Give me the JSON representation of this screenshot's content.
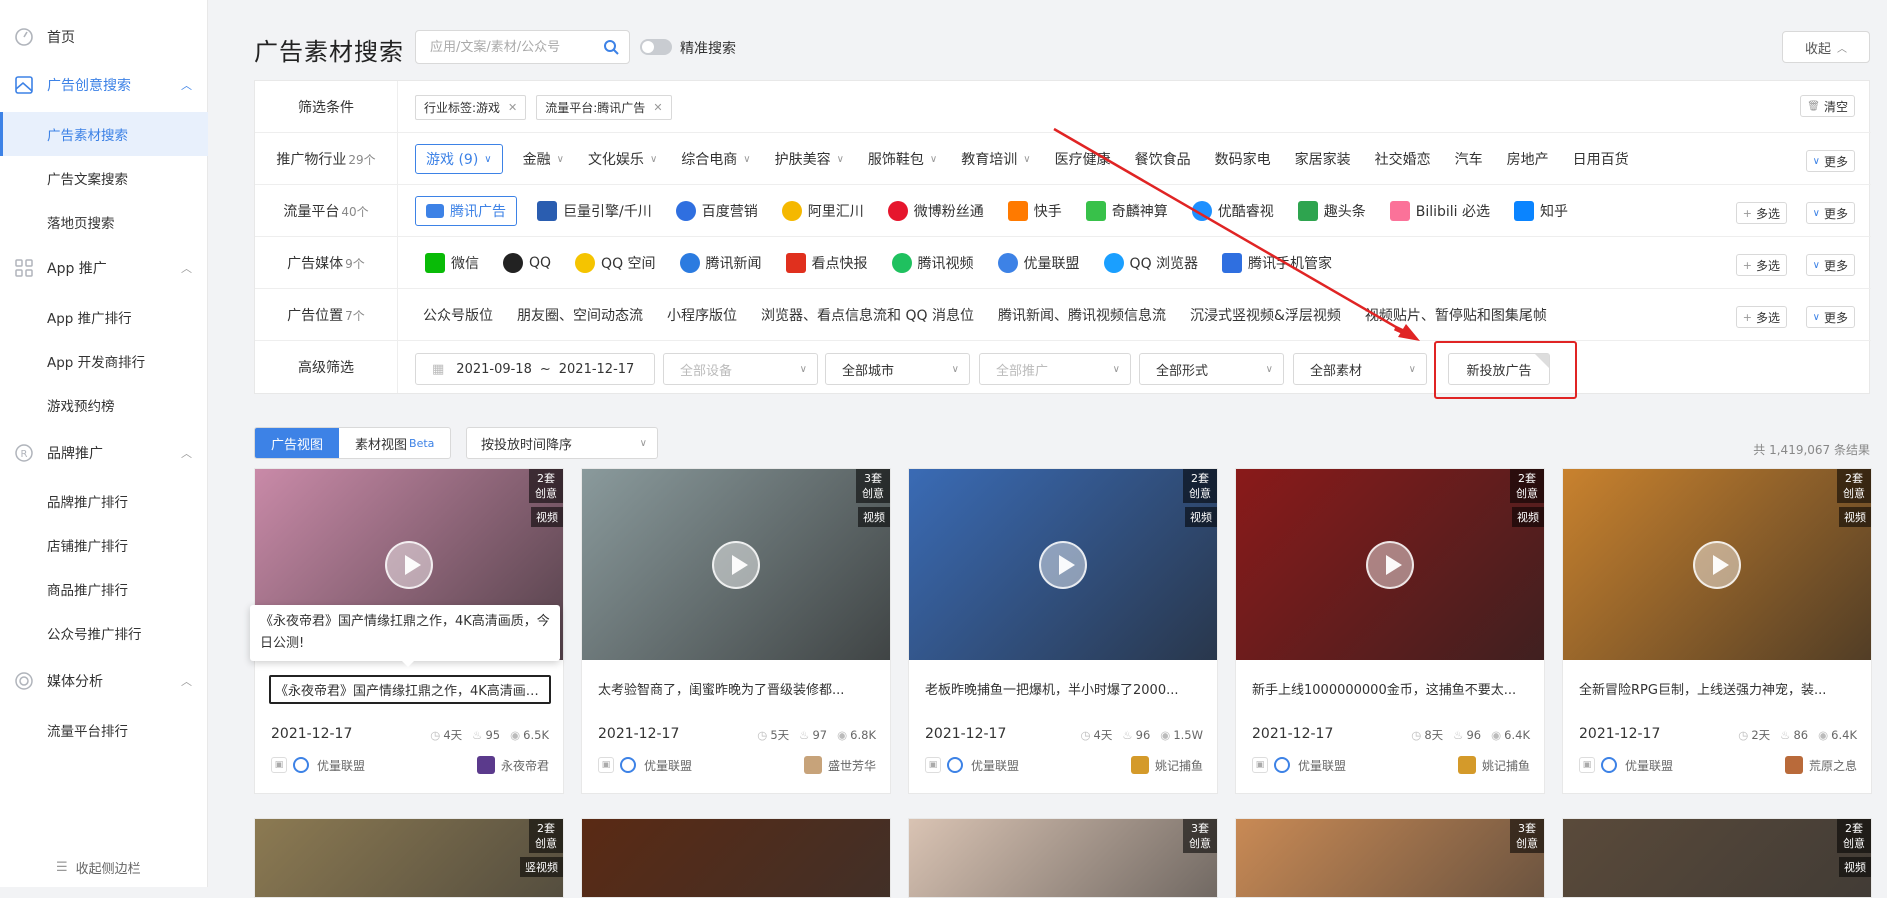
{
  "sidebar": {
    "items": [
      {
        "label": "首页",
        "icon": "dashboard-icon"
      },
      {
        "label": "广告创意搜索",
        "icon": "creative-icon"
      },
      {
        "label": "App 推广",
        "icon": "apps-icon"
      },
      {
        "label": "品牌推广",
        "icon": "brand-icon"
      },
      {
        "label": "媒体分析",
        "icon": "media-icon"
      }
    ],
    "sub_creative": [
      "广告素材搜索",
      "广告文案搜索",
      "落地页搜索"
    ],
    "sub_app": [
      "App 推广排行",
      "App 开发商排行",
      "游戏预约榜"
    ],
    "sub_brand": [
      "品牌推广排行",
      "店铺推广排行",
      "商品推广排行",
      "公众号推广排行"
    ],
    "sub_media": [
      "流量平台排行"
    ],
    "collapse_label": "收起侧边栏"
  },
  "header": {
    "title": "广告素材搜索",
    "search_placeholder": "应用/文案/素材/公众号",
    "precise_label": "精准搜索",
    "collapse_label": "收起"
  },
  "filters": {
    "conditions_label": "筛选条件",
    "active_tags": [
      "行业标签:游戏",
      "流量平台:腾讯广告"
    ],
    "clear_label": "清空",
    "industry": {
      "label": "推广物行业",
      "count": "29个",
      "selected": "游戏 (9)",
      "options": [
        "金融",
        "文化娱乐",
        "综合电商",
        "护肤美容",
        "服饰鞋包",
        "教育培训",
        "医疗健康",
        "餐饮食品",
        "数码家电",
        "家居家装",
        "社交婚恋",
        "汽车",
        "房地产",
        "日用百货"
      ]
    },
    "platform": {
      "label": "流量平台",
      "count": "40个",
      "selected": "腾讯广告",
      "options": [
        "巨量引擎/千川",
        "百度营销",
        "阿里汇川",
        "微博粉丝通",
        "快手",
        "奇麟神算",
        "优酷睿视",
        "趣头条",
        "Bilibili 必选",
        "知乎"
      ]
    },
    "media": {
      "label": "广告媒体",
      "count": "9个",
      "options": [
        "微信",
        "QQ",
        "QQ 空间",
        "腾讯新闻",
        "看点快报",
        "腾讯视频",
        "优量联盟",
        "QQ 浏览器",
        "腾讯手机管家"
      ]
    },
    "position": {
      "label": "广告位置",
      "count": "7个",
      "options": [
        "公众号版位",
        "朋友圈、空间动态流",
        "小程序版位",
        "浏览器、看点信息流和 QQ 消息位",
        "腾讯新闻、腾讯视频信息流",
        "沉浸式竖视频&浮层视频",
        "视频贴片、暂停贴和图集尾帧"
      ]
    },
    "advanced": {
      "label": "高级筛选",
      "date_start": "2021-09-18",
      "date_sep": "~",
      "date_end": "2021-12-17",
      "device": "全部设备",
      "city": "全部城市",
      "promo": "全部推广",
      "form": "全部形式",
      "material": "全部素材",
      "new_ads": "新投放广告"
    },
    "more_label": "更多",
    "multi_label": "多选"
  },
  "view": {
    "tab_ad": "广告视图",
    "tab_material": "素材视图",
    "beta": "Beta",
    "sort": "按投放时间降序",
    "total": "共 1,419,067 条结果"
  },
  "tooltip": "《永夜帝君》国产情缘扛鼎之作，4K高清画质，今日公测!",
  "cards": [
    {
      "badge1": "2套",
      "badge2": "创意",
      "type": "视频",
      "desc": "《永夜帝君》国产情缘扛鼎之作，4K高清画质，今日公测!",
      "date": "2021-12-17",
      "days": "4天",
      "heat": "95",
      "views": "6.5K",
      "media": "优量联盟",
      "advertiser": "永夜帝君",
      "bg": "#c98aa8",
      "av": "#5b3a8c"
    },
    {
      "badge1": "3套",
      "badge2": "创意",
      "type": "视频",
      "desc": "太考验智商了，闺蜜昨晚为了晋级装修都...",
      "date": "2021-12-17",
      "days": "5天",
      "heat": "97",
      "views": "6.8K",
      "media": "优量联盟",
      "advertiser": "盛世芳华",
      "bg": "#8a9a9c",
      "av": "#c7a37a"
    },
    {
      "badge1": "2套",
      "badge2": "创意",
      "type": "视频",
      "desc": "老板昨晚捕鱼一把爆机，半小时爆了2000...",
      "date": "2021-12-17",
      "days": "4天",
      "heat": "96",
      "views": "1.5W",
      "media": "优量联盟",
      "advertiser": "姚记捕鱼",
      "bg": "#3a6bb5",
      "av": "#d49a2a"
    },
    {
      "badge1": "2套",
      "badge2": "创意",
      "type": "视频",
      "desc": "新手上线1000000000金币，这捕鱼不要太...",
      "date": "2021-12-17",
      "days": "8天",
      "heat": "96",
      "views": "6.4K",
      "media": "优量联盟",
      "advertiser": "姚记捕鱼",
      "bg": "#8a1a1a",
      "av": "#d49a2a"
    },
    {
      "badge1": "2套",
      "badge2": "创意",
      "type": "视频",
      "desc": "全新冒险RPG巨制，上线送强力神宠，装...",
      "date": "2021-12-17",
      "days": "2天",
      "heat": "86",
      "views": "6.4K",
      "media": "优量联盟",
      "advertiser": "荒原之息",
      "bg": "#c9822e",
      "av": "#b96a3a"
    }
  ],
  "cards_row2": [
    {
      "badge1": "2套",
      "badge2": "创意",
      "type": "竖视频",
      "bg": "#8c7a52"
    },
    {
      "badge1": "",
      "badge2": "",
      "type": "",
      "bg": "#5a2a14"
    },
    {
      "badge1": "3套",
      "badge2": "创意",
      "type": "",
      "bg": "#d9c3b3"
    },
    {
      "badge1": "3套",
      "badge2": "创意",
      "type": "",
      "bg": "#c98a55"
    },
    {
      "badge1": "2套",
      "badge2": "创意",
      "type": "视频",
      "bg": "#5a4a3a"
    }
  ],
  "colors": {
    "accent": "#3d82e6",
    "highlight": "#e02424"
  }
}
